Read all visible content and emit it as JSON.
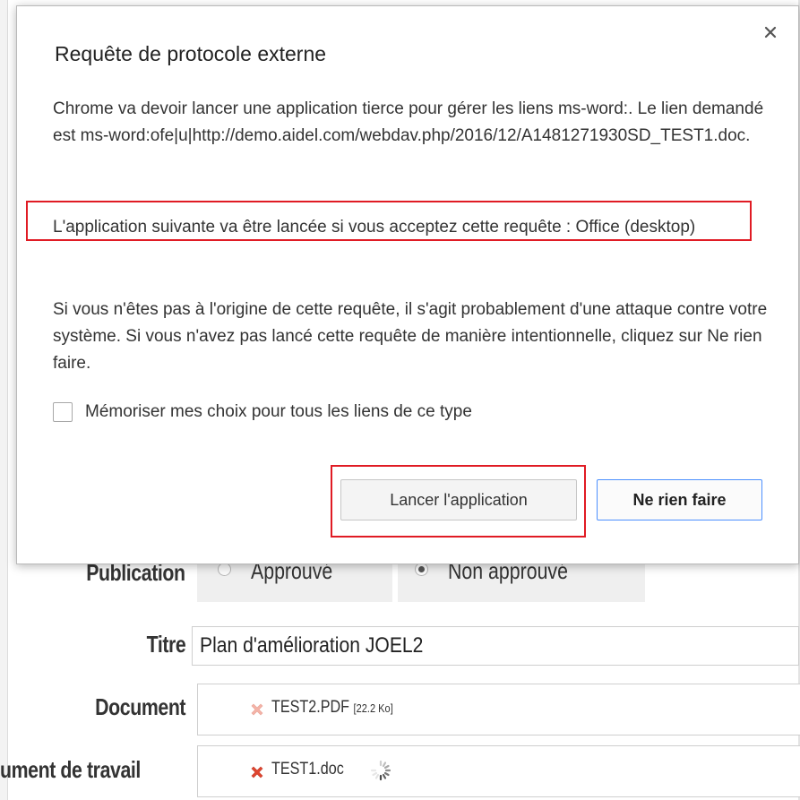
{
  "dialog": {
    "title": "Requête de protocole externe",
    "close_glyph": "×",
    "paragraph1": "Chrome va devoir lancer une application tierce pour gérer les liens ms-word:. Le lien demandé est ms-word:ofe|u|http://demo.aidel.com/webdav.php/2016/12/A1481271930SD_TEST1.doc.",
    "paragraph2": "L'application suivante va être lancée si vous acceptez cette requête : Office (desktop)",
    "paragraph3": "Si vous n'êtes pas à l'origine de cette requête, il s'agit probablement d'une attaque contre votre système. Si vous n'avez pas lancé cette requête de manière intentionnelle, cliquez sur Ne rien faire.",
    "checkbox_label": "Mémoriser mes choix pour tous les liens de ce type",
    "checkbox_checked": false,
    "launch_button": "Lancer l'application",
    "nothing_button": "Ne rien faire",
    "highlight_color": "#e01b24",
    "focus_color": "#4d90fe"
  },
  "background": {
    "publication_label": "Publication",
    "radio_approved": "Approuvé",
    "radio_not_approved": "Non approuvé",
    "selected_radio": "Non approuvé",
    "title_label": "Titre",
    "title_value": "Plan d'amélioration JOEL2",
    "document_label": "Document",
    "document_file": "TEST2.PDF",
    "document_size": "[22.2 Ko]",
    "working_doc_label": "ument de travail",
    "working_doc_file": "TEST1.doc",
    "delete_icon": "red-x-icon",
    "loading_icon": "spinner-icon"
  }
}
